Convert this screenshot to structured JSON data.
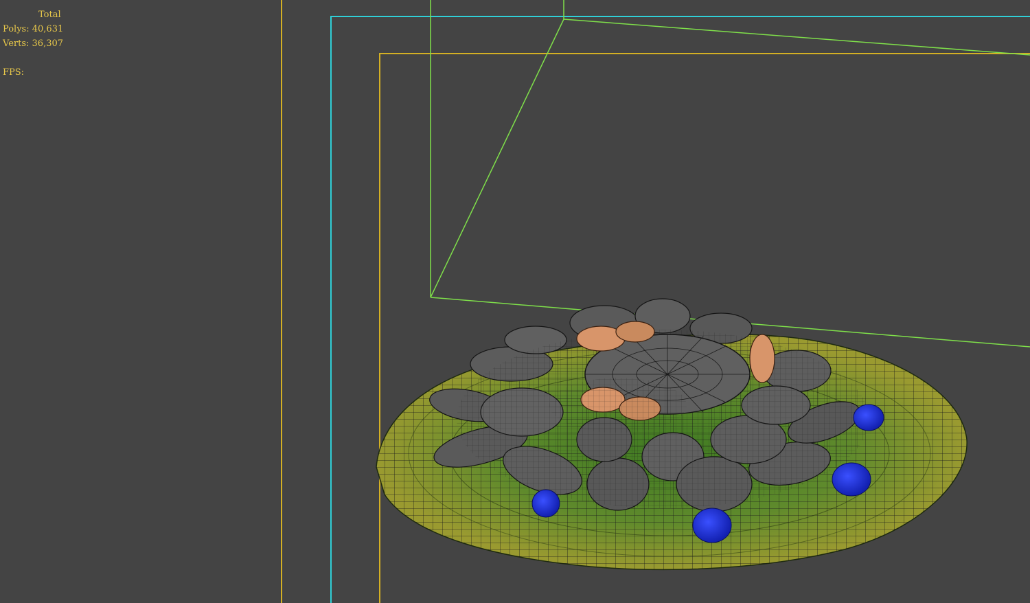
{
  "stats": {
    "total_label": "Total",
    "polys_label": "Polys:",
    "polys_value": "40,631",
    "verts_label": "Verts:",
    "verts_value": "36,307",
    "fps_label": "FPS:"
  },
  "colors": {
    "background": "#444444",
    "stats_text": "#e8c84a",
    "safe_frame_outer": "#d4b024",
    "safe_frame_mid": "#2fd0d8",
    "safe_frame_inner": "#d4b024",
    "camera_frustum": "#7fe04a",
    "lily_pad": "#5f8a2c",
    "petal": "#5a5a5a",
    "seed_pod": "#d8956a",
    "berry": "#1a2fd8"
  }
}
